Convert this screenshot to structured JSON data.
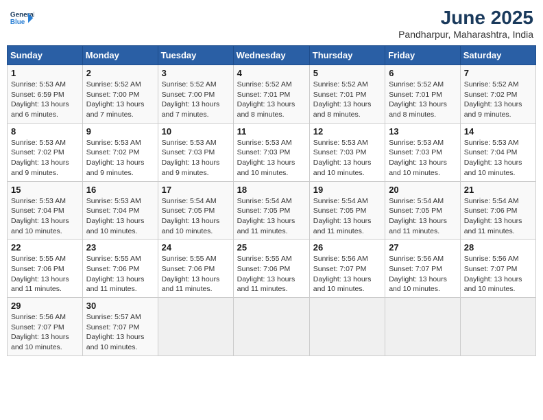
{
  "logo": {
    "line1": "General",
    "line2": "Blue"
  },
  "title": "June 2025",
  "subtitle": "Pandharpur, Maharashtra, India",
  "days_of_week": [
    "Sunday",
    "Monday",
    "Tuesday",
    "Wednesday",
    "Thursday",
    "Friday",
    "Saturday"
  ],
  "weeks": [
    [
      {
        "day": "1",
        "sunrise": "5:53 AM",
        "sunset": "6:59 PM",
        "daylight": "13 hours and 6 minutes."
      },
      {
        "day": "2",
        "sunrise": "5:52 AM",
        "sunset": "7:00 PM",
        "daylight": "13 hours and 7 minutes."
      },
      {
        "day": "3",
        "sunrise": "5:52 AM",
        "sunset": "7:00 PM",
        "daylight": "13 hours and 7 minutes."
      },
      {
        "day": "4",
        "sunrise": "5:52 AM",
        "sunset": "7:01 PM",
        "daylight": "13 hours and 8 minutes."
      },
      {
        "day": "5",
        "sunrise": "5:52 AM",
        "sunset": "7:01 PM",
        "daylight": "13 hours and 8 minutes."
      },
      {
        "day": "6",
        "sunrise": "5:52 AM",
        "sunset": "7:01 PM",
        "daylight": "13 hours and 8 minutes."
      },
      {
        "day": "7",
        "sunrise": "5:52 AM",
        "sunset": "7:02 PM",
        "daylight": "13 hours and 9 minutes."
      }
    ],
    [
      {
        "day": "8",
        "sunrise": "5:53 AM",
        "sunset": "7:02 PM",
        "daylight": "13 hours and 9 minutes."
      },
      {
        "day": "9",
        "sunrise": "5:53 AM",
        "sunset": "7:02 PM",
        "daylight": "13 hours and 9 minutes."
      },
      {
        "day": "10",
        "sunrise": "5:53 AM",
        "sunset": "7:03 PM",
        "daylight": "13 hours and 9 minutes."
      },
      {
        "day": "11",
        "sunrise": "5:53 AM",
        "sunset": "7:03 PM",
        "daylight": "13 hours and 10 minutes."
      },
      {
        "day": "12",
        "sunrise": "5:53 AM",
        "sunset": "7:03 PM",
        "daylight": "13 hours and 10 minutes."
      },
      {
        "day": "13",
        "sunrise": "5:53 AM",
        "sunset": "7:03 PM",
        "daylight": "13 hours and 10 minutes."
      },
      {
        "day": "14",
        "sunrise": "5:53 AM",
        "sunset": "7:04 PM",
        "daylight": "13 hours and 10 minutes."
      }
    ],
    [
      {
        "day": "15",
        "sunrise": "5:53 AM",
        "sunset": "7:04 PM",
        "daylight": "13 hours and 10 minutes."
      },
      {
        "day": "16",
        "sunrise": "5:53 AM",
        "sunset": "7:04 PM",
        "daylight": "13 hours and 10 minutes."
      },
      {
        "day": "17",
        "sunrise": "5:54 AM",
        "sunset": "7:05 PM",
        "daylight": "13 hours and 10 minutes."
      },
      {
        "day": "18",
        "sunrise": "5:54 AM",
        "sunset": "7:05 PM",
        "daylight": "13 hours and 11 minutes."
      },
      {
        "day": "19",
        "sunrise": "5:54 AM",
        "sunset": "7:05 PM",
        "daylight": "13 hours and 11 minutes."
      },
      {
        "day": "20",
        "sunrise": "5:54 AM",
        "sunset": "7:05 PM",
        "daylight": "13 hours and 11 minutes."
      },
      {
        "day": "21",
        "sunrise": "5:54 AM",
        "sunset": "7:06 PM",
        "daylight": "13 hours and 11 minutes."
      }
    ],
    [
      {
        "day": "22",
        "sunrise": "5:55 AM",
        "sunset": "7:06 PM",
        "daylight": "13 hours and 11 minutes."
      },
      {
        "day": "23",
        "sunrise": "5:55 AM",
        "sunset": "7:06 PM",
        "daylight": "13 hours and 11 minutes."
      },
      {
        "day": "24",
        "sunrise": "5:55 AM",
        "sunset": "7:06 PM",
        "daylight": "13 hours and 11 minutes."
      },
      {
        "day": "25",
        "sunrise": "5:55 AM",
        "sunset": "7:06 PM",
        "daylight": "13 hours and 11 minutes."
      },
      {
        "day": "26",
        "sunrise": "5:56 AM",
        "sunset": "7:07 PM",
        "daylight": "13 hours and 10 minutes."
      },
      {
        "day": "27",
        "sunrise": "5:56 AM",
        "sunset": "7:07 PM",
        "daylight": "13 hours and 10 minutes."
      },
      {
        "day": "28",
        "sunrise": "5:56 AM",
        "sunset": "7:07 PM",
        "daylight": "13 hours and 10 minutes."
      }
    ],
    [
      {
        "day": "29",
        "sunrise": "5:56 AM",
        "sunset": "7:07 PM",
        "daylight": "13 hours and 10 minutes."
      },
      {
        "day": "30",
        "sunrise": "5:57 AM",
        "sunset": "7:07 PM",
        "daylight": "13 hours and 10 minutes."
      },
      null,
      null,
      null,
      null,
      null
    ]
  ],
  "labels": {
    "sunrise": "Sunrise:",
    "sunset": "Sunset:",
    "daylight": "Daylight: "
  }
}
